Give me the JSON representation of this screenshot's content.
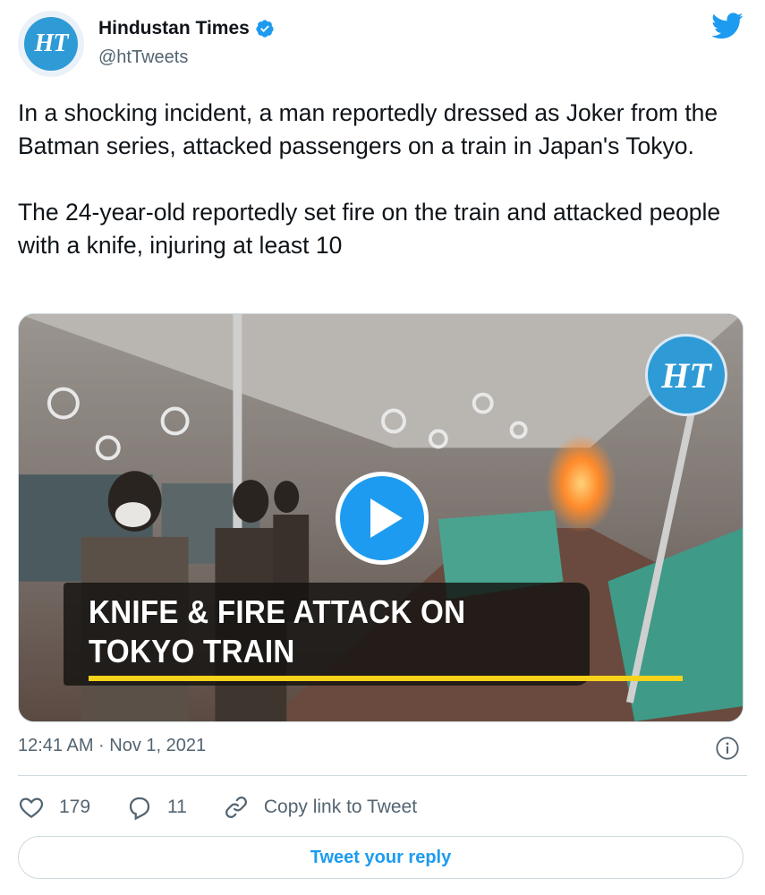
{
  "author": {
    "name": "Hindustan Times",
    "handle": "@htTweets",
    "avatar_text": "HT",
    "verified": true
  },
  "tweet": {
    "paragraphs": [
      "In a shocking incident, a man reportedly dressed as Joker from the Batman series, attacked passengers on a train in Japan's Tokyo.",
      "The 24-year-old reportedly set fire on the train and attacked people with a knife, injuring at least 10"
    ]
  },
  "media": {
    "logo_text": "HT",
    "banner_line1": "KNIFE & FIRE ATTACK ON",
    "banner_line2": "TOKYO TRAIN",
    "icon": "play-icon"
  },
  "meta": {
    "timestamp": "12:41 AM · Nov 1, 2021"
  },
  "actions": {
    "likes": "179",
    "replies": "11",
    "copy_link_label": "Copy link to Tweet"
  },
  "reply_button_label": "Tweet your reply",
  "colors": {
    "accent": "#1d9bf0",
    "muted_text": "#536471",
    "text": "#0f1419",
    "banner_stripe": "#f7d21a"
  }
}
